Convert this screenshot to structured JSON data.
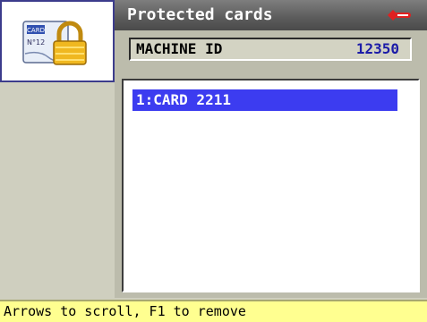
{
  "header": {
    "title": "Protected cards",
    "logo_icon": "silca-key-logo-icon"
  },
  "sidebar": {
    "icon": "protected-card-lock-icon",
    "icon_card_text": "CARD",
    "icon_number_text": "N°12"
  },
  "machine": {
    "label": "MACHINE ID",
    "value": "12350"
  },
  "cards_list": {
    "items": [
      {
        "label": "1:CARD 2211",
        "selected": true
      }
    ]
  },
  "status": {
    "text": "Arrows to scroll, F1 to remove"
  },
  "colors": {
    "selection": "#3c3cf0",
    "machine_value": "#1c1ca8",
    "statusbar": "#ffff90",
    "titlebar": "#5b5b5b"
  }
}
